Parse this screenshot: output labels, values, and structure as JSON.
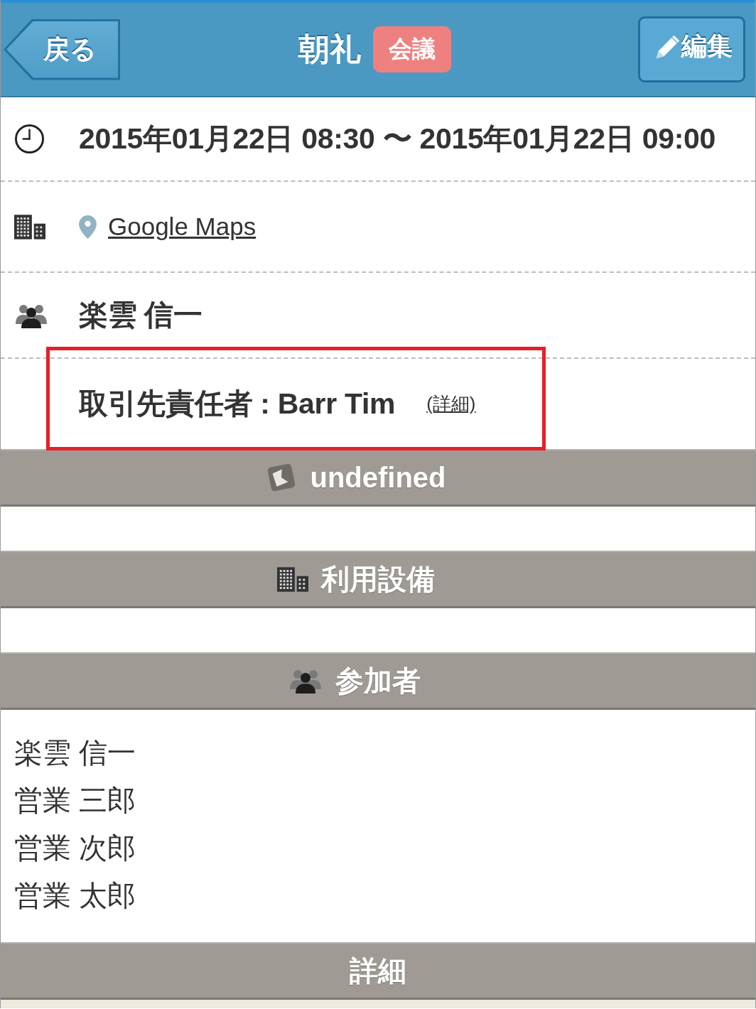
{
  "top_bar": {
    "back_button": "戻る",
    "title": "朝礼",
    "badge": "会議",
    "edit_button": "編集"
  },
  "details": [
    {
      "kind": "time",
      "text": "2015年01月22日 08:30 〜 2015年01月22日 09:00"
    },
    {
      "kind": "location",
      "link": "Google Maps"
    },
    {
      "kind": "person",
      "text": "楽雲 信一"
    },
    {
      "kind": "contact",
      "text": "取引先責任者 : Barr Tim",
      "link": "(詳細)",
      "highlighted": true
    }
  ],
  "sections": [
    {
      "kind": "image",
      "title": "undefined"
    },
    {
      "kind": "facilities",
      "title": "利用設備"
    },
    {
      "kind": "participants",
      "title": "参加者",
      "items": [
        "楽雲 信一",
        "営業 三郎",
        "営業 次郎",
        "営業 太郎"
      ]
    },
    {
      "kind": "plain",
      "title": "詳細"
    }
  ]
}
